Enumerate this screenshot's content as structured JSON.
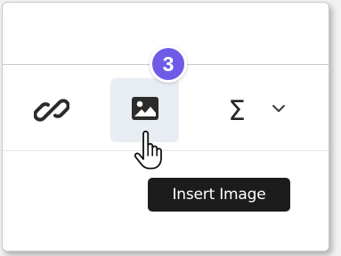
{
  "badge": {
    "step": "3",
    "color": "#6f5ce6"
  },
  "toolbar": {
    "buttons": [
      {
        "name": "link",
        "icon": "link-icon"
      },
      {
        "name": "insert-image",
        "icon": "image-icon",
        "state": "hovered"
      },
      {
        "name": "equation",
        "icon": "sigma-icon",
        "label": "Σ"
      },
      {
        "name": "equation-dropdown",
        "icon": "chevron-down-icon"
      }
    ],
    "hover_bg": "#e7edf3"
  },
  "tooltip": {
    "text": "Insert Image"
  },
  "cursor": {
    "icon": "hand-pointer-icon"
  }
}
